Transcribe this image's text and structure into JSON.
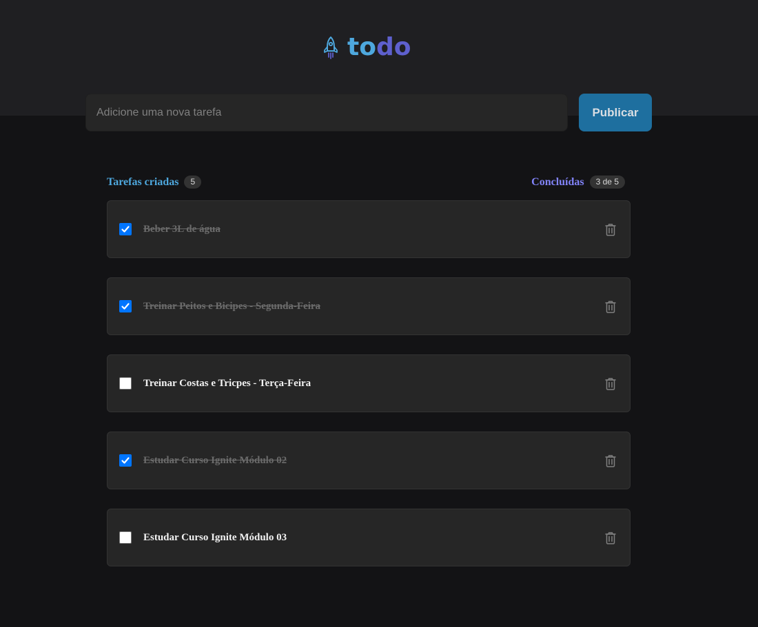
{
  "header": {
    "logo_icon": "rocket-icon",
    "logo_part1": "to",
    "logo_part2": "do",
    "colors": {
      "logo_part1": "#4ea8de",
      "logo_part2": "#5e60ce"
    }
  },
  "new_task": {
    "placeholder": "Adicione uma nova tarefa",
    "value": "",
    "button_label": "Publicar"
  },
  "counters": {
    "created_label": "Tarefas criadas",
    "created_count": "5",
    "done_label": "Concluídas",
    "done_count": "3 de 5"
  },
  "tasks": [
    {
      "text": "Beber 3L de água",
      "done": true
    },
    {
      "text": "Treinar Peitos e Bicipes - Segunda-Feira",
      "done": true
    },
    {
      "text": "Treinar Costas e Tricpes - Terça-Feira",
      "done": false
    },
    {
      "text": "Estudar Curso Ignite Módulo 02",
      "done": true
    },
    {
      "text": "Estudar Curso Ignite Módulo 03",
      "done": false
    }
  ],
  "icons": {
    "task_delete": "trash-icon",
    "task_toggle": "checkbox"
  },
  "colors": {
    "accent_blue": "#4ea8de",
    "accent_purple": "#8284fa",
    "button": "#1e6f9f",
    "checkbox_checked": "#0075ff"
  }
}
